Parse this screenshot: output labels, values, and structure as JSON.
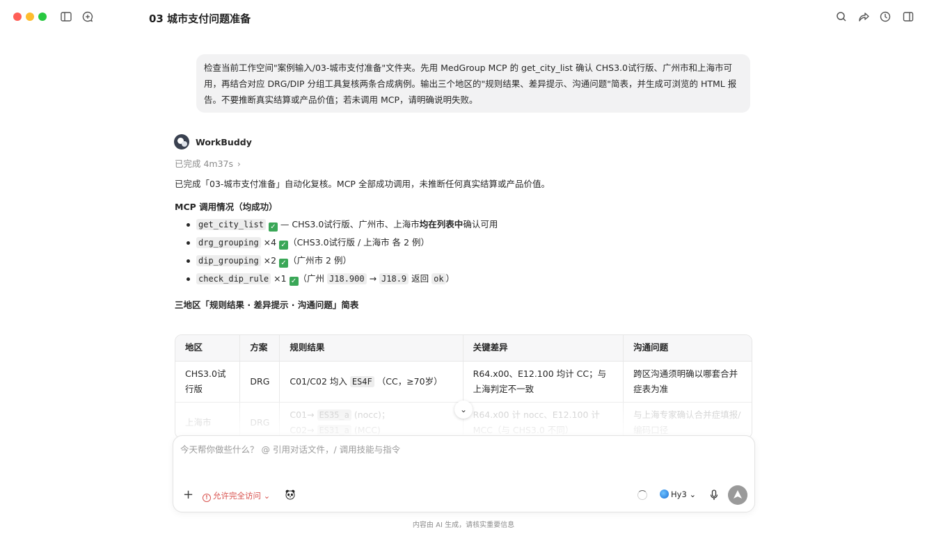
{
  "window": {
    "title": "03 城市支付问题准备"
  },
  "user_message": "检查当前工作空间\"案例输入/03-城市支付准备\"文件夹。先用 MedGroup MCP 的 get_city_list 确认 CHS3.0试行版、广州市和上海市可用，再结合对应 DRG/DIP 分组工具复核两条合成病例。输出三个地区的\"规则结果、差异提示、沟通问题\"简表，并生成可浏览的 HTML 报告。不要推断真实结算或产品价值；若未调用 MCP，请明确说明失败。",
  "assistant": {
    "name": "WorkBuddy",
    "status": "已完成 4m37s",
    "summary": "已完成「03-城市支付准备」自动化复核。MCP 全部成功调用，未推断任何真实结算或产品价值。",
    "mcp_heading": "MCP 调用情况（均成功）",
    "mcp_items": [
      {
        "code": "get_city_list",
        "pre": " — CHS3.0试行版、广州市、上海市",
        "bold": "均在列表中",
        "post": "确认可用"
      },
      {
        "code": "drg_grouping",
        "pre": " ×4 ",
        "post": "（CHS3.0试行版 / 上海市 各 2 例）"
      },
      {
        "code": "dip_grouping",
        "pre": " ×2 ",
        "post": "（广州市 2 例）"
      },
      {
        "code": "check_dip_rule",
        "pre": " ×1 ",
        "post_a": "（广州 ",
        "code2": "J18.900",
        "arrow": " → ",
        "code3": "J18.9",
        "post_b": " 返回 ",
        "code4": "ok",
        "post_c": "）"
      }
    ],
    "table_heading": "三地区「规则结果 · 差异提示 · 沟通问题」简表",
    "table": {
      "headers": [
        "地区",
        "方案",
        "规则结果",
        "关键差异",
        "沟通问题"
      ],
      "rows": [
        {
          "region": "CHS3.0试行版",
          "scheme": "DRG",
          "rule_pre": "C01/C02 均入 ",
          "rule_code": "ES4F",
          "rule_post": " （CC，≥70岁）",
          "diff": "R64.x00、E12.100 均计 CC；与上海判定不一致",
          "issue": "跨区沟通须明确以哪套合并症表为准"
        },
        {
          "region": "上海市",
          "scheme": "DRG",
          "rule_line1_pre": "C01→ ",
          "rule_line1_code": "ES35_a",
          "rule_line1_post": " (nocc)；",
          "rule_line2_pre": "C02→ ",
          "rule_line2_code": "ES31_a",
          "rule_line2_post": " (MCC)",
          "diff": "R64.x00 计 nocc、E12.100 计 MCC（与 CHS3.0 不同）",
          "issue": "与上海专家确认合并症填报/编码口径"
        }
      ]
    }
  },
  "composer": {
    "placeholder": "今天帮你做些什么？ @ 引用对话文件，/ 调用技能与指令",
    "access_label": "允许完全访问",
    "model_label": "Hy3"
  },
  "footer": "内容由 AI 生成，请核实重要信息",
  "colors": {
    "accent_red": "#d9534f",
    "bubble_bg": "#f2f2f3",
    "check_green": "#3aa757"
  },
  "icons": [
    "sidebar-toggle-icon",
    "new-chat-icon",
    "search-icon",
    "share-icon",
    "history-icon",
    "panel-icon",
    "chevron-right-icon",
    "chevron-down-icon",
    "plus-icon",
    "warning-icon",
    "panda-icon",
    "spinner-icon",
    "globe-icon",
    "mic-icon",
    "send-icon"
  ]
}
